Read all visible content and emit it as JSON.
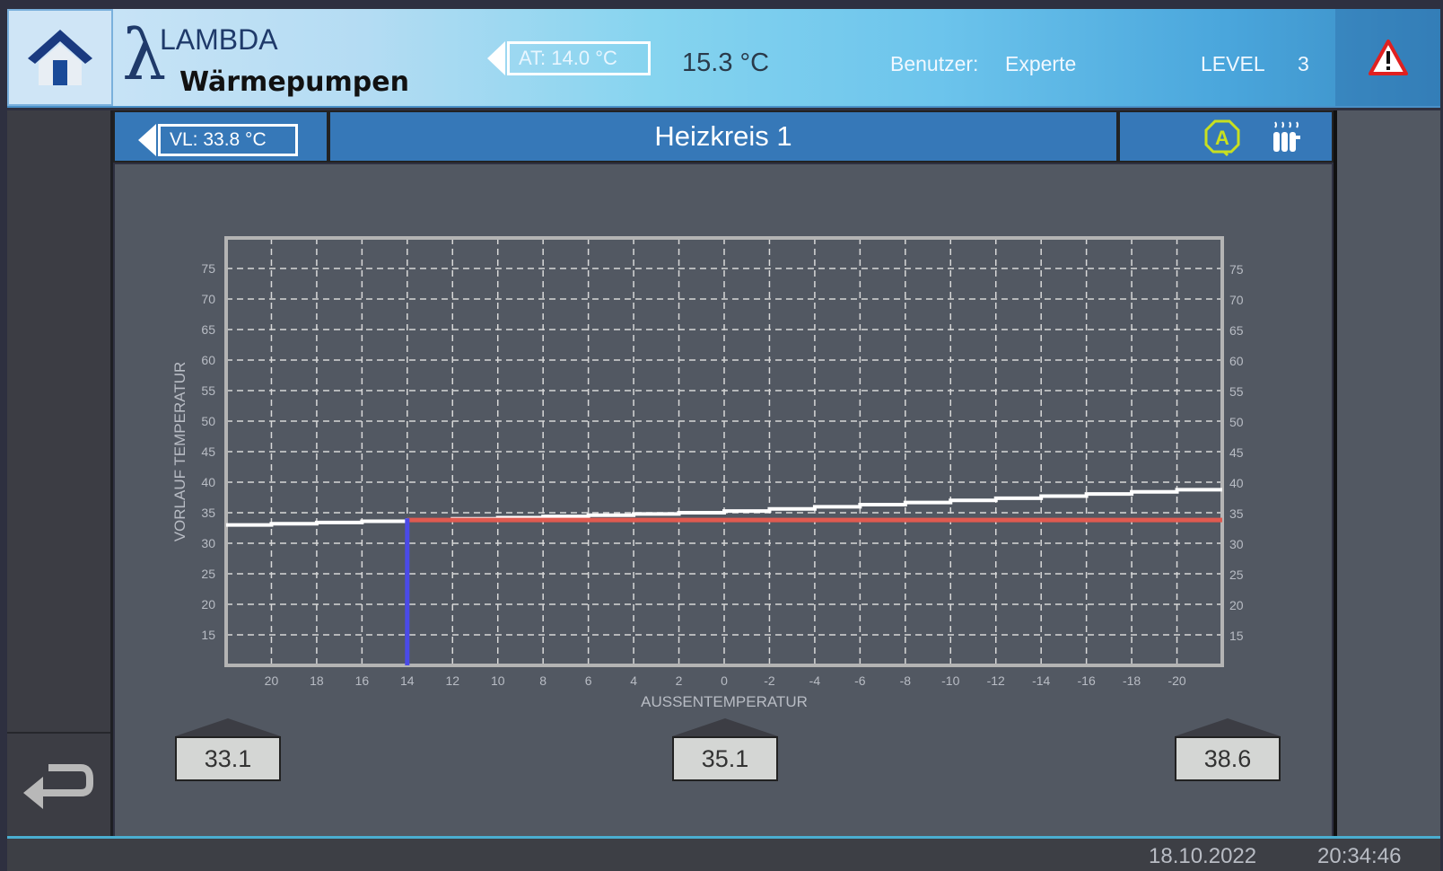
{
  "header": {
    "logo_symbol": "λ",
    "logo_line1": "LAMBDA",
    "logo_line2": "Wärmepumpen",
    "at_label": "AT: 14.0 °C",
    "outdoor_temp": "15.3 °C",
    "user_label": "Benutzer:",
    "user_value": "Experte",
    "level_label": "LEVEL",
    "level_value": "3"
  },
  "subheader": {
    "vl_label": "VL: 33.8 °C",
    "title": "Heizkreis 1"
  },
  "icons": {
    "home": "home-icon",
    "alarm": "warning-triangle-icon",
    "auto": "auto-mode-icon",
    "radiator": "radiator-icon",
    "back": "back-arrow-icon"
  },
  "markers": [
    {
      "value": "33.1"
    },
    {
      "value": "35.1"
    },
    {
      "value": "38.6"
    }
  ],
  "footer": {
    "date": "18.10.2022",
    "time": "20:34:46"
  },
  "colors": {
    "curve": "#ffffff",
    "setpoint_line": "#e05a50",
    "outdoor_marker": "#4a4ae8",
    "auto_icon": "#c8e020"
  },
  "chart_data": {
    "type": "line",
    "xlabel": "AUSSENTEMPERATUR",
    "ylabel": "VORLAUF TEMPERATUR",
    "xlim": [
      22,
      -22
    ],
    "ylim": [
      10,
      80
    ],
    "x_ticks": [
      20,
      18,
      16,
      14,
      12,
      10,
      8,
      6,
      4,
      2,
      0,
      -2,
      -4,
      -6,
      -8,
      -10,
      -12,
      -14,
      -16,
      -18,
      -20
    ],
    "y_ticks": [
      15,
      20,
      25,
      30,
      35,
      40,
      45,
      50,
      55,
      60,
      65,
      70,
      75
    ],
    "grid": true,
    "heating_curve": {
      "x": [
        20,
        0,
        -20
      ],
      "y": [
        33.1,
        35.1,
        38.6
      ]
    },
    "outdoor_temperature": 14.0,
    "flow_setpoint": 33.8
  }
}
